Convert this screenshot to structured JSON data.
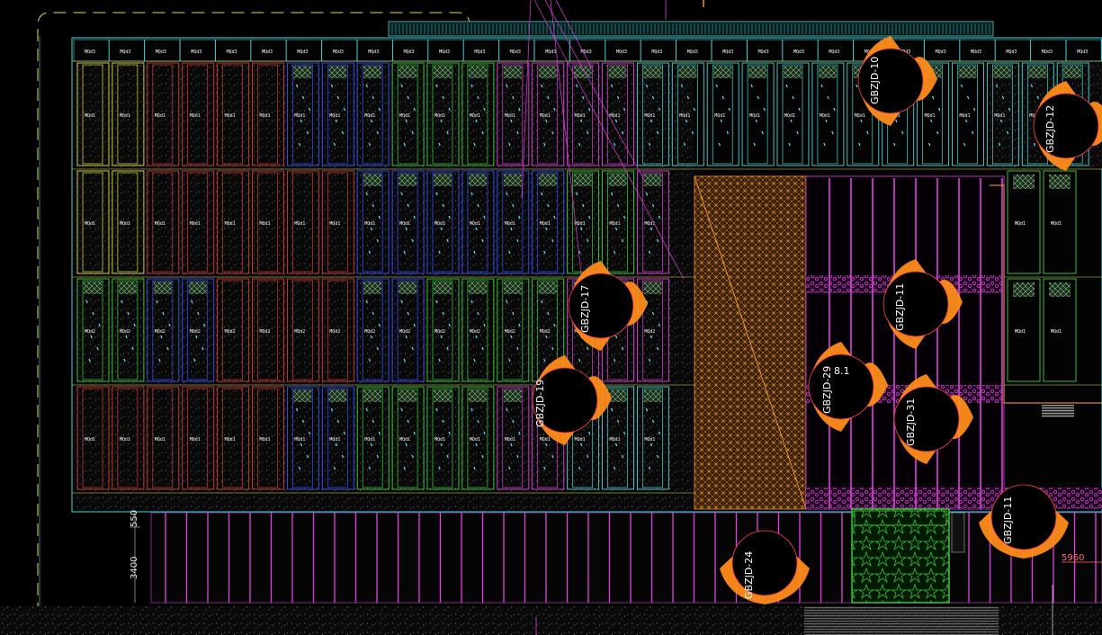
{
  "row_labels": {
    "row0": "MQd3",
    "row1": "MQd1",
    "row2": "MQd1",
    "row3": "MQd2",
    "row4": "MQd1"
  },
  "dimensions": {
    "left_top": "550",
    "left_bottom": "3400",
    "right": "5960"
  },
  "symbols": [
    {
      "id": "sym-a",
      "label": "GBZJD-10"
    },
    {
      "id": "sym-b",
      "label": "GBZJD-12"
    },
    {
      "id": "sym-c",
      "label": "GBZJD-17"
    },
    {
      "id": "sym-d",
      "label": "GBZJD-19"
    },
    {
      "id": "sym-e",
      "label": "GBZJD-11"
    },
    {
      "id": "sym-f",
      "label": "GBZJD-29"
    },
    {
      "id": "sym-g",
      "label": "GBZJD-31"
    },
    {
      "id": "sym-h",
      "label": "GBZJD-24"
    },
    {
      "id": "sym-i",
      "label": "GBZJD-11"
    }
  ],
  "symbol_subtext": {
    "f": "8.1"
  },
  "colors": {
    "background": "#000000",
    "grid_cyan": "#4ad6d6",
    "magenta": "#e040e0",
    "orange": "#ff8c1a",
    "yellow": "#e0e040",
    "red": "#d23c3c",
    "blue": "#3a50ff",
    "green": "#3cd23c"
  }
}
